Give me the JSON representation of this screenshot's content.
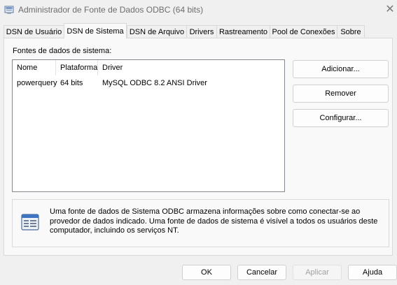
{
  "window": {
    "title": "Administrador de Fonte de Dados ODBC (64 bits)",
    "app_icon": "odbc-admin-icon",
    "close_icon": "close-icon"
  },
  "tabs": [
    {
      "label": "DSN de Usuário",
      "active": false
    },
    {
      "label": "DSN de Sistema",
      "active": true
    },
    {
      "label": "DSN de Arquivo",
      "active": false
    },
    {
      "label": "Drivers",
      "active": false
    },
    {
      "label": "Rastreamento",
      "active": false
    },
    {
      "label": "Pool de Conexões",
      "active": false
    },
    {
      "label": "Sobre",
      "active": false
    }
  ],
  "system_dsn": {
    "section_label": "Fontes de dados de sistema:",
    "columns": [
      "Nome",
      "Plataforma",
      "Driver"
    ],
    "rows": [
      {
        "name": "powerquery",
        "platform": "64 bits",
        "driver": "MySQL ODBC 8.2 ANSI Driver"
      }
    ]
  },
  "side_buttons": {
    "add": "Adicionar...",
    "remove": "Remover",
    "configure": "Configurar..."
  },
  "info": {
    "icon": "data-source-icon",
    "text": "Uma fonte de dados de Sistema ODBC armazena informações sobre como conectar-se ao provedor de dados indicado. Uma fonte de dados de sistema é visível a todos os usuários deste computador, incluindo os serviços NT."
  },
  "dialog_buttons": {
    "ok": "OK",
    "cancel": "Cancelar",
    "apply": "Aplicar",
    "help": "Ajuda"
  }
}
